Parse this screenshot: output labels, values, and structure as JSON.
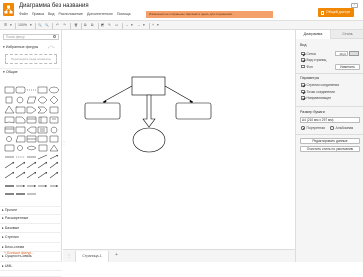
{
  "header": {
    "title": "Диаграмма без названия",
    "menu": [
      "Файл",
      "Правка",
      "Вид",
      "Расположение",
      "Дополнительно",
      "Помощь"
    ],
    "notice": "Изменения не сохранены. Щёлкните здесь для сохранения.",
    "share_label": "Общий доступ",
    "collapse_glyph": "⌃"
  },
  "toolbar": {
    "zoom": "100%",
    "items": [
      "☰",
      "▾",
      "🔍",
      "🔍",
      "↶",
      "↷",
      "🗑",
      "⧉",
      "⧉",
      "◩",
      "✎",
      "▭",
      "→",
      "▾",
      "+",
      "▾"
    ]
  },
  "sidebar": {
    "search_placeholder": "Поиск фигур",
    "favorites_label": "Избранные фигуры",
    "favorites_actions": "⤢ ✎",
    "favorites_drop": "Перетащите сюда элементы",
    "general_label": "Общие",
    "categories": [
      "Прочее",
      "Расширенные",
      "Базовые",
      "Стрелки",
      "Блок-схема",
      "Сущность-связь",
      "UML"
    ],
    "more_shapes": "+ Больше фигур..."
  },
  "pages": {
    "tab_label": "Страница-1",
    "more_glyph": "⋮",
    "add_glyph": "+"
  },
  "panel": {
    "tabs": [
      "Диаграмма",
      "Стиль"
    ],
    "view_head": "Вид",
    "grid_label": "Сетка",
    "grid_size": "10 pt",
    "page_view_label": "Вид страниц",
    "background_label": "Фон",
    "change_btn": "Изменить",
    "params_head": "Параметры",
    "connection_arrows": "Стрелки соединения",
    "connection_points": "Точки соединения",
    "guides": "Направляющие",
    "paper_head": "Размер бумаги",
    "paper_value": "A4 (210 мм x 297 мм)",
    "portrait": "Портретная",
    "landscape": "Альбомная",
    "edit_data_btn": "Редактировать данные",
    "reset_style_btn": "Очистить стиль по умолчанию"
  },
  "colors": {
    "accent": "#f08705",
    "notice_bg": "#f3a06b"
  }
}
